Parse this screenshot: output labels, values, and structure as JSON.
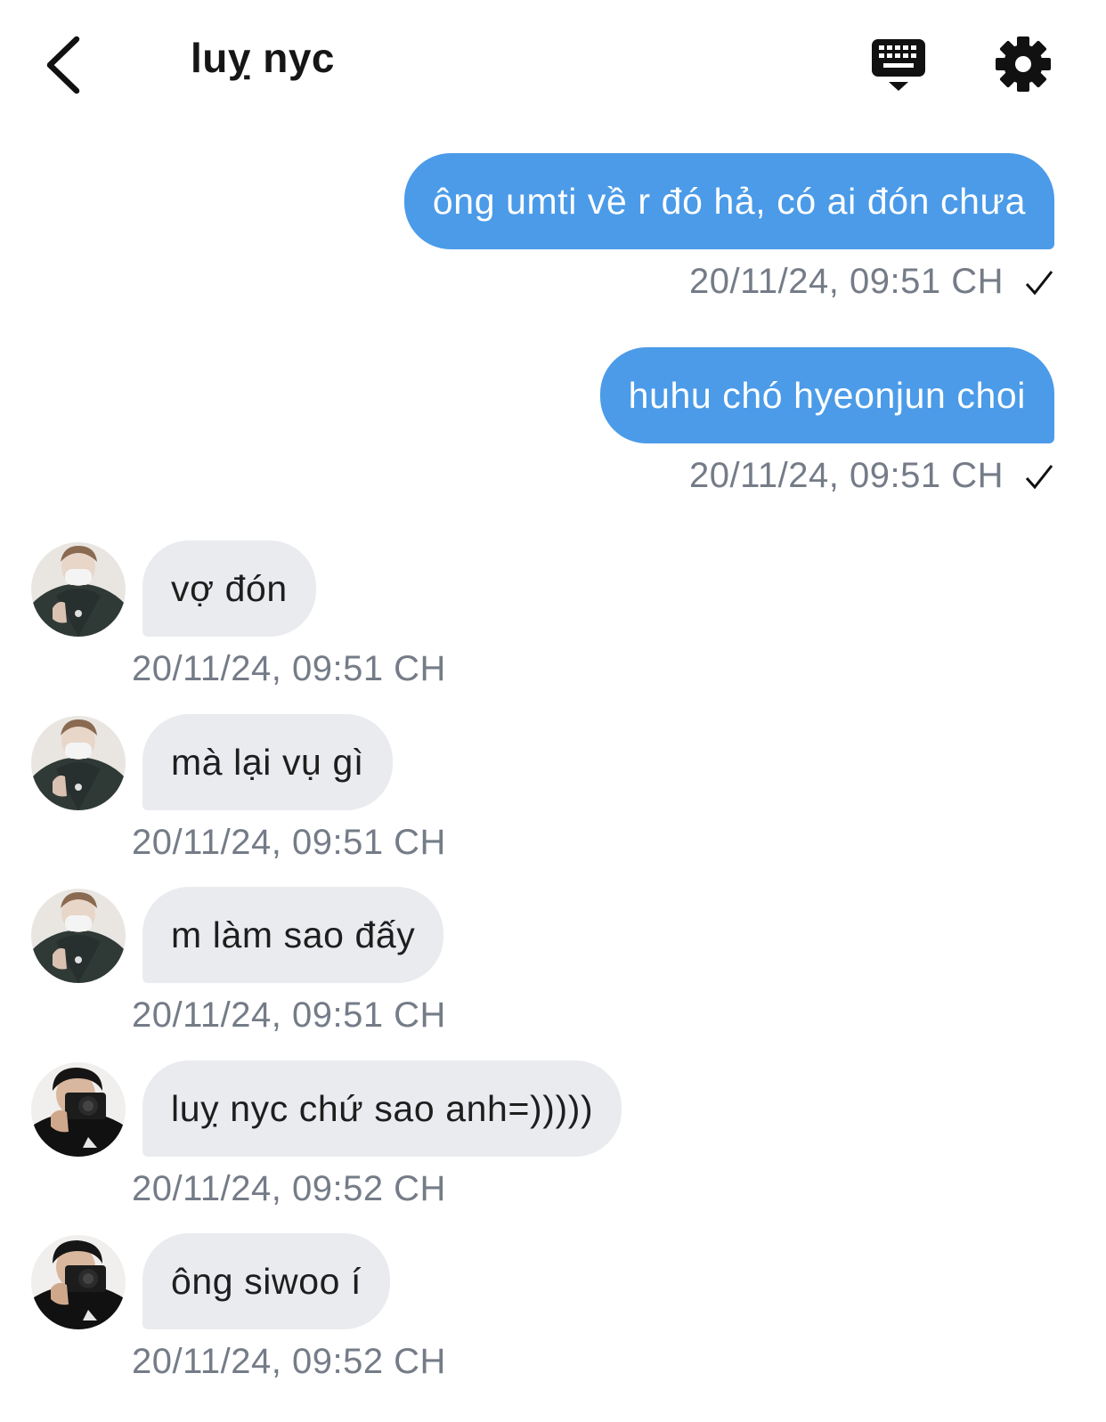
{
  "header": {
    "title": "luỵ nyc",
    "back_icon": "chevron-left-icon",
    "keyboard_icon": "keyboard-icon",
    "settings_icon": "gear-icon"
  },
  "colors": {
    "outgoing_bubble": "#4b9be8",
    "incoming_bubble": "#e9ebef",
    "timestamp": "#757c88"
  },
  "messages": [
    {
      "direction": "out",
      "text": "ông umti về r đó hả, có ai đón chưa",
      "time": "20/11/24, 09:51 CH",
      "status": "sent"
    },
    {
      "direction": "out",
      "text": "huhu chó hyeonjun choi",
      "time": "20/11/24, 09:51 CH",
      "status": "sent"
    },
    {
      "direction": "in",
      "avatar": "avatar-1",
      "text": "vợ đón",
      "time": "20/11/24, 09:51 CH"
    },
    {
      "direction": "in",
      "avatar": "avatar-1",
      "text": "mà lại vụ gì",
      "time": "20/11/24, 09:51 CH"
    },
    {
      "direction": "in",
      "avatar": "avatar-1",
      "text": "m làm sao đấy",
      "time": "20/11/24, 09:51 CH"
    },
    {
      "direction": "in",
      "avatar": "avatar-2",
      "text": "luỵ nyc chứ sao anh=)))))",
      "time": "20/11/24, 09:52 CH"
    },
    {
      "direction": "in",
      "avatar": "avatar-2",
      "text": "ông siwoo í",
      "time": "20/11/24, 09:52 CH"
    }
  ]
}
